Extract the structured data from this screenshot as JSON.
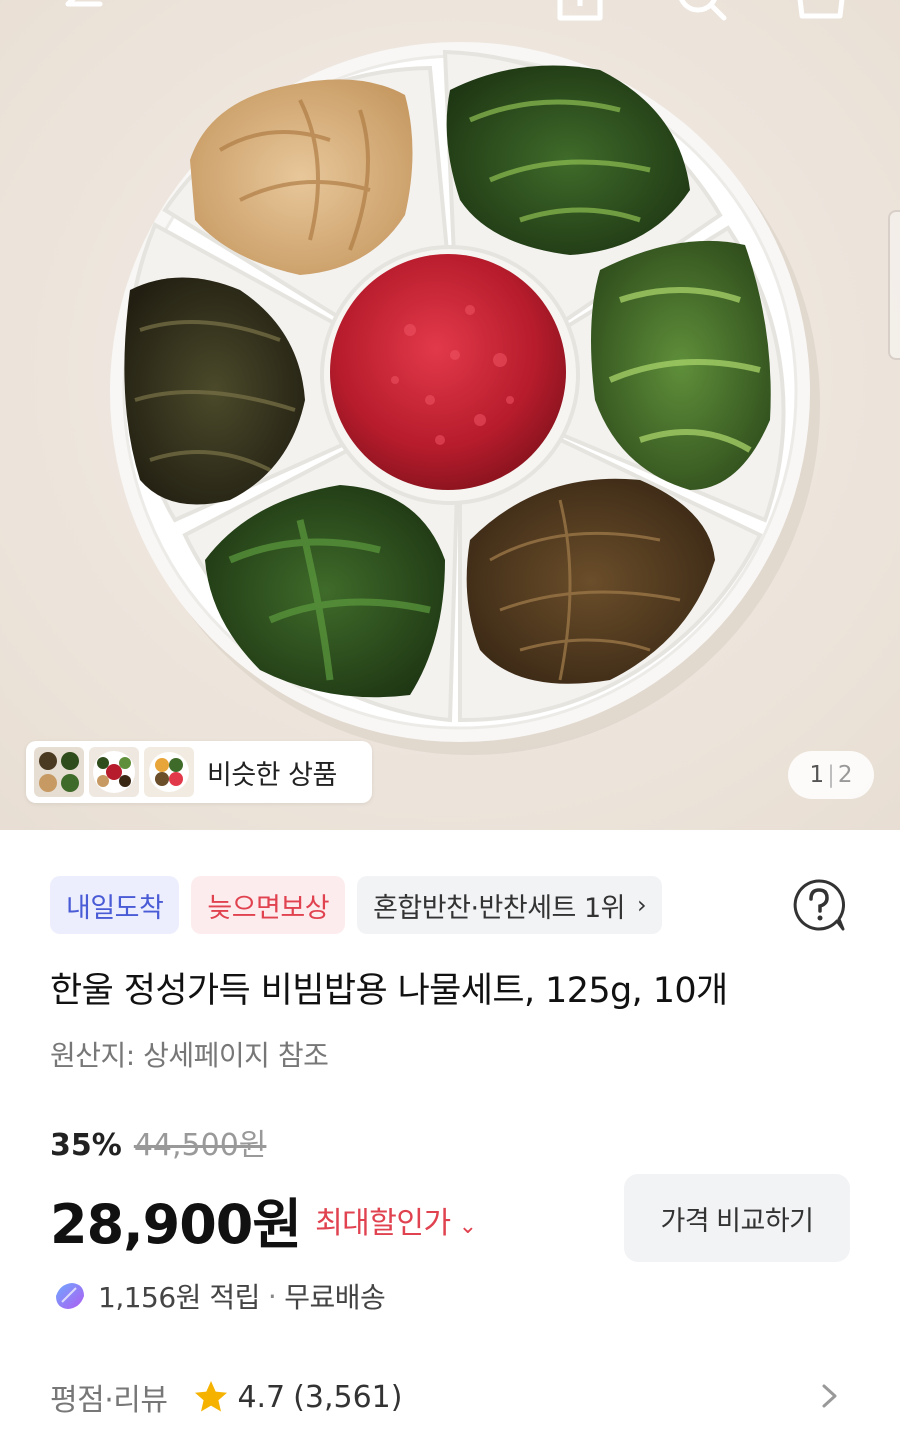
{
  "topbar": {
    "icons": [
      "back-arrow-icon",
      "share-icon",
      "search-icon",
      "cart-icon"
    ]
  },
  "gallery": {
    "similar_label": "비슷한 상품",
    "page_current": "1",
    "page_total": "2"
  },
  "badges": {
    "delivery": "내일도착",
    "late_compensation": "늦으면보상",
    "ranking": "혼합반찬·반찬세트 1위"
  },
  "product": {
    "title": "한울 정성가득 비빔밥용 나물세트, 125g, 10개",
    "origin": "원산지: 상세페이지 참조"
  },
  "price": {
    "discount_rate": "35%",
    "original_price": "44,500원",
    "sale_price": "28,900원",
    "max_discount_label": "최대할인가",
    "compare_button": "가격 비교하기"
  },
  "benefits": {
    "points": "1,156원 적립",
    "shipping": "무료배송"
  },
  "rating": {
    "label": "평점·리뷰",
    "score": "4.7",
    "review_count": "(3,561)"
  },
  "colors": {
    "accent_red": "#e0424f",
    "accent_blue": "#4a5bd6",
    "star": "#f5b300"
  }
}
